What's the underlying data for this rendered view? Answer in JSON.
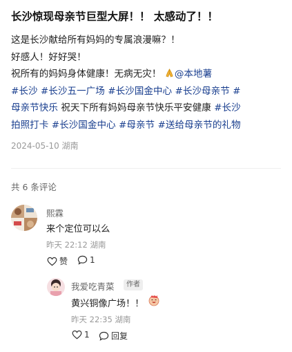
{
  "post": {
    "title": "长沙惊现母亲节巨型大屏！！ 太感动了！！",
    "lines": {
      "l1": "这是长沙献给所有妈妈的专属浪漫嘛？！",
      "l2": "好感人！好好哭！",
      "l3_text": "祝所有的妈妈身体健康！无病无灾！",
      "l3_mention": "@本地薯",
      "tag_changsha": "#长沙",
      "tag_wuyi": "#长沙五一广场",
      "tag_ifs": "#长沙国金中心",
      "tag_mothersday_cs": "#长沙母亲节",
      "tag_hash": "#",
      "tag_happy": "母亲节快乐",
      "blessing": "祝天下所有妈妈母亲节快乐平安健康",
      "tag_cs2": "#长沙",
      "tag_photo": "拍照打卡",
      "tag_ifs2": "#长沙国金中心",
      "tag_md": "#母亲节",
      "tag_gift": "#送给母亲节的礼物"
    },
    "date_location": "2024-05-10 湖南",
    "icons": {
      "pray": "folded-hands-icon"
    }
  },
  "comments_header": {
    "count_label": "共 6 条评论"
  },
  "comments": [
    {
      "author": "熙霖",
      "text": "来个定位可以么",
      "time_location": "昨天 22:12 湖南",
      "like_label": "赞",
      "reply_count": "1",
      "icons": {
        "like": "heart-icon",
        "reply": "chat-bubble-icon"
      }
    }
  ],
  "reply": {
    "author": "我爱吃青菜",
    "badge": "作者",
    "text": "黄兴铜像广场！！",
    "time_location": "昨天 22:35 湖南",
    "like_count": "1",
    "reply_label": "回复",
    "icons": {
      "like": "heart-icon",
      "reply": "chat-bubble-icon",
      "emoji": "laughing-face-icon"
    }
  },
  "colors": {
    "tag": "#1a3f8f",
    "meta": "#999999",
    "text": "#222222"
  }
}
